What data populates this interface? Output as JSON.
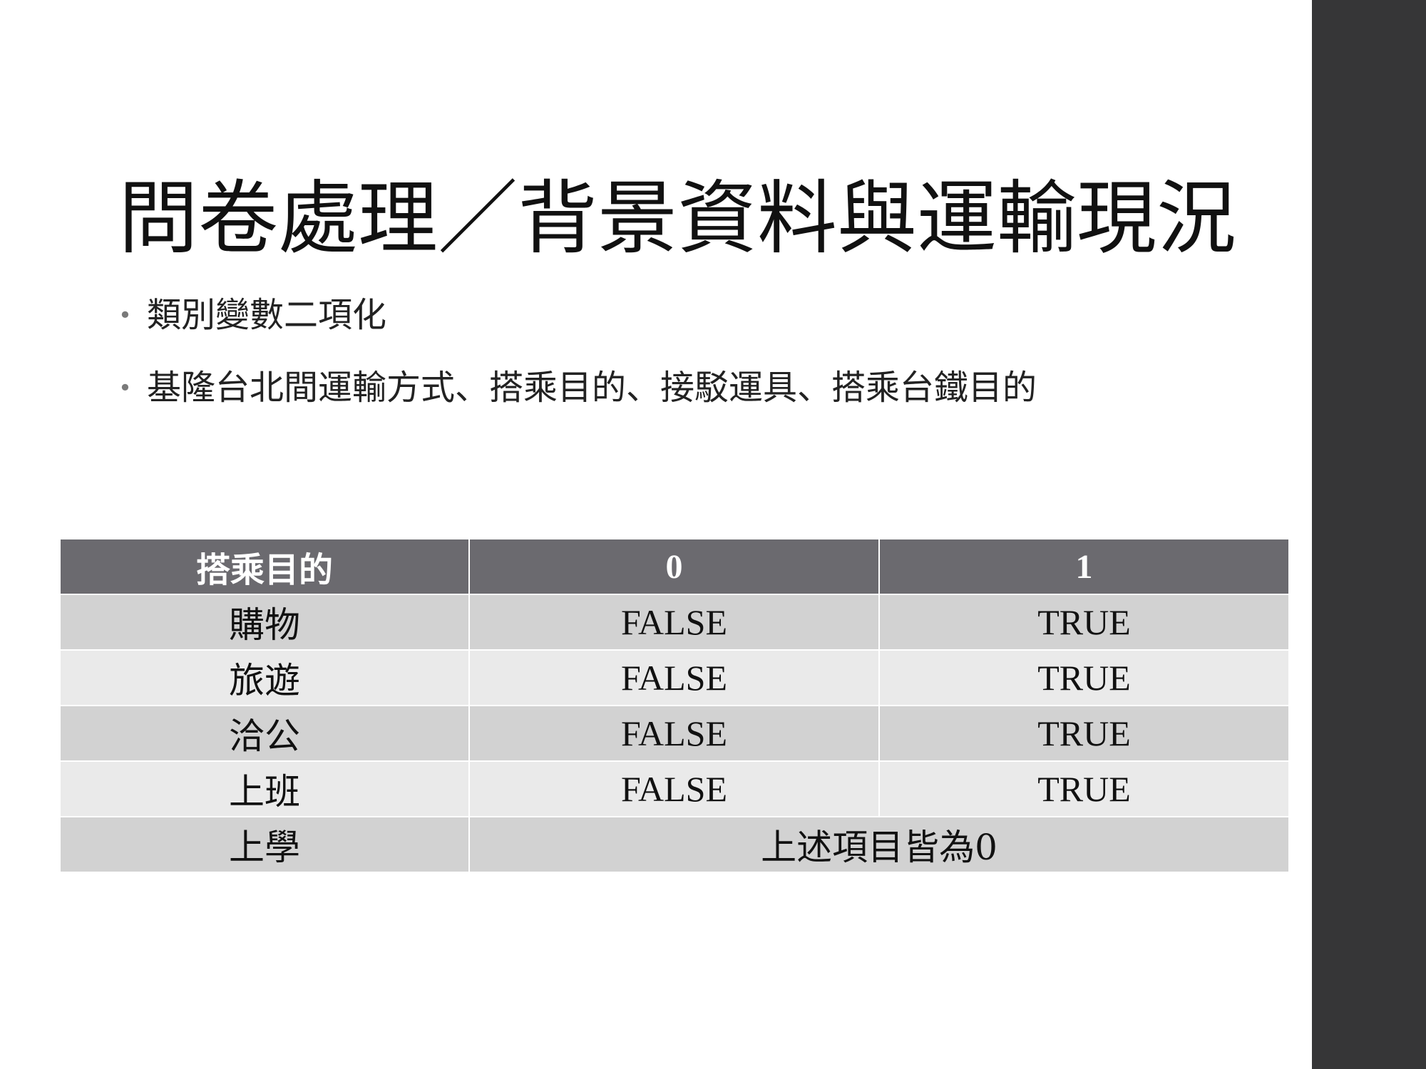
{
  "slide": {
    "title": "問卷處理／背景資料與運輸現況",
    "bullets": [
      "類別變數二項化",
      "基隆台北間運輸方式、搭乘目的、接駁運具、搭乘台鐵目的"
    ],
    "bullet_glyph": "•"
  },
  "table": {
    "headers": [
      "搭乘目的",
      "0",
      "1"
    ],
    "rows": [
      [
        "購物",
        "FALSE",
        "TRUE"
      ],
      [
        "旅遊",
        "FALSE",
        "TRUE"
      ],
      [
        "洽公",
        "FALSE",
        "TRUE"
      ],
      [
        "上班",
        "FALSE",
        "TRUE"
      ]
    ],
    "last_row": {
      "label": "上學",
      "merged_value": "上述項目皆為0"
    }
  },
  "colors": {
    "side_band": "#363637",
    "header_bg": "#6b6a6f",
    "row_odd_bg": "#d2d2d2",
    "row_even_bg": "#eaeaea"
  }
}
